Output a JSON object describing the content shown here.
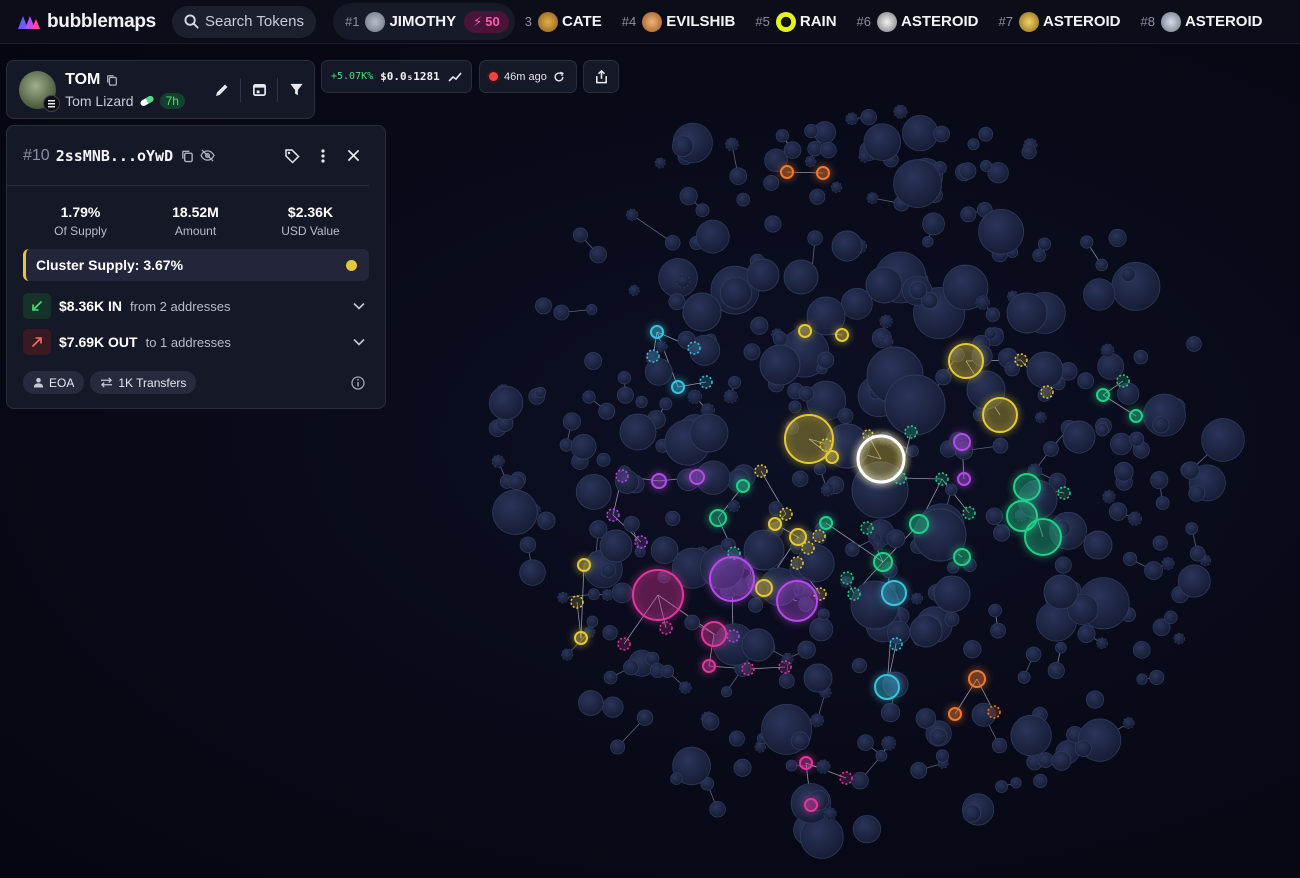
{
  "app": {
    "logo_text": "bubblemaps",
    "search_placeholder": "Search Tokens"
  },
  "trending": [
    {
      "rank": "#1",
      "name": "JIMOTHY",
      "boost": "50",
      "logo_color": "#8a8f9e"
    },
    {
      "rank": "3",
      "name": "CATE",
      "logo_color": "#c9932a"
    },
    {
      "rank": "#4",
      "name": "EVILSHIB",
      "logo_color": "#d98c44"
    },
    {
      "rank": "#5",
      "name": "RAIN",
      "logo_color": "#d7e81f"
    },
    {
      "rank": "#6",
      "name": "ASTEROID",
      "logo_color": "#cfcfcf"
    },
    {
      "rank": "#7",
      "name": "ASTEROID",
      "logo_color": "#d1a52f"
    },
    {
      "rank": "#8",
      "name": "ASTEROID",
      "logo_color": "#9aa4b8"
    }
  ],
  "token": {
    "symbol": "TOM",
    "name": "Tom Lizard",
    "age": "7h"
  },
  "price": {
    "change": "+5.07K%",
    "value": "$0.0₅1281"
  },
  "updated": "46m ago",
  "address_panel": {
    "rank": "#10",
    "address": "2ssMNB...oYwD",
    "supply_value": "1.79%",
    "supply_label": "Of Supply",
    "amount_value": "18.52M",
    "amount_label": "Amount",
    "usd_value": "$2.36K",
    "usd_label": "USD Value",
    "cluster_supply": "Cluster Supply: 3.67%",
    "cluster_color": "#e3c93a",
    "in_amount": "$8.36K IN",
    "in_sub": "from 2 addresses",
    "out_amount": "$7.69K OUT",
    "out_sub": "to 1 addresses",
    "tag_type": "EOA",
    "tag_transfers": "1K Transfers"
  },
  "colors": {
    "background": "#080a18",
    "bubble_default": "#1e2640",
    "bubble_stroke": "#2f3a5c",
    "cluster_yellow": "#e3c93a",
    "cluster_green": "#22d08a",
    "cluster_purple": "#b54be8",
    "cluster_pink": "#e0379e",
    "cluster_cyan": "#38c4e0",
    "cluster_orange": "#f07a2a",
    "selected_stroke": "#ffffff"
  }
}
